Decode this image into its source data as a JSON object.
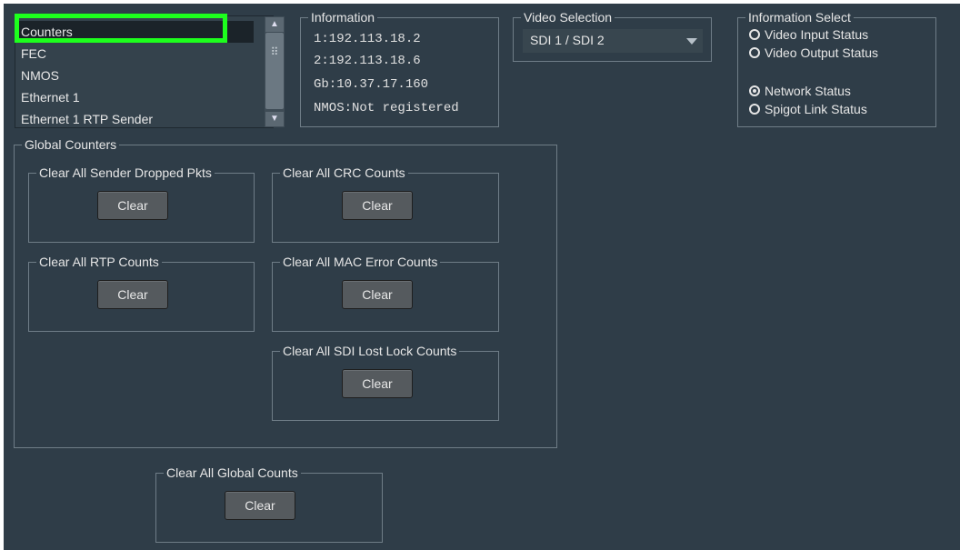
{
  "list": {
    "items": [
      "Counters",
      "FEC",
      "NMOS",
      "Ethernet 1",
      "Ethernet 1 RTP Sender"
    ],
    "selected_index": 0,
    "scroll_up_icon": "triangle-up-icon",
    "scroll_down_icon": "triangle-down-icon"
  },
  "information": {
    "title": "Information",
    "lines": [
      "1:192.113.18.2",
      "2:192.113.18.6",
      "Gb:10.37.17.160",
      "NMOS:Not registered"
    ]
  },
  "video_selection": {
    "title": "Video Selection",
    "value": "SDI 1 / SDI 2"
  },
  "information_select": {
    "title": "Information Select",
    "options": [
      "Video Input Status",
      "Video Output Status",
      "Network Status",
      "Spigot Link Status"
    ],
    "selected": "Network Status"
  },
  "global_counters": {
    "title": "Global Counters",
    "groups": [
      {
        "title": "Clear All Sender Dropped Pkts",
        "button": "Clear"
      },
      {
        "title": "Clear All CRC Counts",
        "button": "Clear"
      },
      {
        "title": "Clear All RTP Counts",
        "button": "Clear"
      },
      {
        "title": "Clear All MAC Error Counts",
        "button": "Clear"
      },
      {
        "title": "Clear All SDI Lost Lock Counts",
        "button": "Clear"
      }
    ]
  },
  "clear_all_global": {
    "title": "Clear All Global Counts",
    "button": "Clear"
  },
  "colors": {
    "panel_bg": "#2f3d48",
    "highlight": "#1dff1d",
    "selected_item_bg": "#1b2329"
  }
}
